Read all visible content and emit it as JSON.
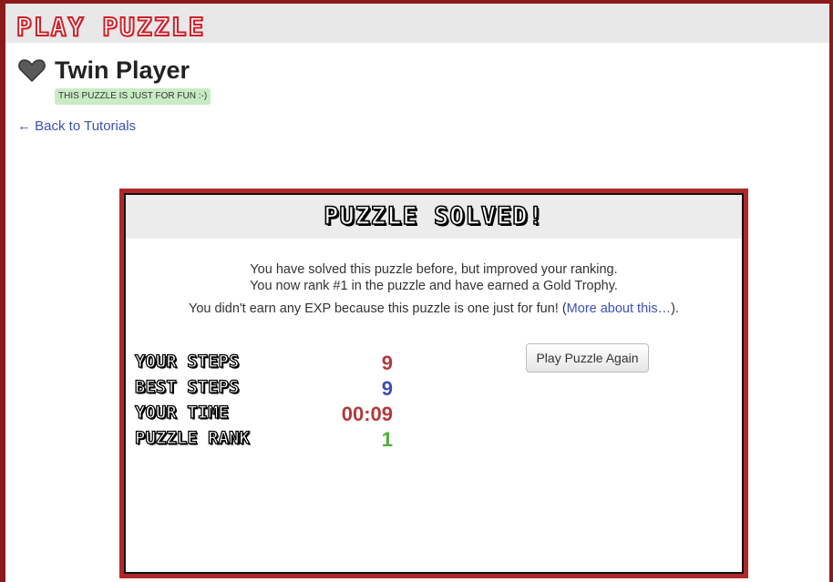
{
  "header": {
    "logo": "PLAY PUZZLE"
  },
  "puzzle": {
    "title": "Twin Player",
    "badge": "THIS PUZZLE IS JUST FOR FUN :-)",
    "back_link": "← Back to Tutorials"
  },
  "result": {
    "heading": "PUZZLE SOLVED!",
    "line1": "You have solved this puzzle before, but improved your ranking.",
    "line2": "You now rank #1 in the puzzle and have earned a Gold Trophy.",
    "exp_text": "You didn't earn any EXP because this puzzle is one just for fun! (",
    "exp_link": "More about this…",
    "exp_end": ").",
    "stats": [
      {
        "label": "YOUR STEPS",
        "value": "9",
        "color": "#b23a3a"
      },
      {
        "label": "BEST STEPS",
        "value": "9",
        "color": "#3d4db3"
      },
      {
        "label": "YOUR TIME",
        "value": "00:09",
        "color": "#b23a3a"
      },
      {
        "label": "PUZZLE RANK",
        "value": "1",
        "color": "#4caf37"
      }
    ],
    "play_again": "Play Puzzle Again"
  },
  "colors": {
    "frame": "#8b1a1a",
    "panel_border": "#b02828",
    "link": "#3b4fb8",
    "badge_bg": "#c8ecc3"
  },
  "icons": {
    "favorite": "heart-icon"
  }
}
